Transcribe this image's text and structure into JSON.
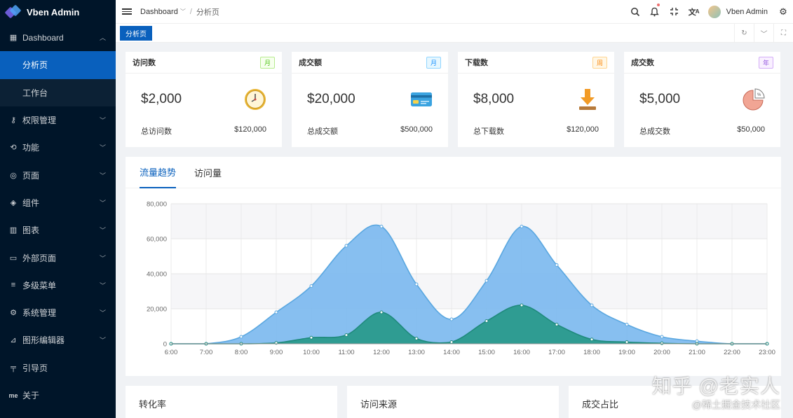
{
  "app": {
    "title": "Vben Admin"
  },
  "sidebar": {
    "dashboard": "Dashboard",
    "sub_items": [
      "分析页",
      "工作台"
    ],
    "items": [
      {
        "label": "权限管理",
        "icon": "key-icon"
      },
      {
        "label": "功能",
        "icon": "function-icon"
      },
      {
        "label": "页面",
        "icon": "page-icon"
      },
      {
        "label": "组件",
        "icon": "component-icon"
      },
      {
        "label": "图表",
        "icon": "chart-icon"
      },
      {
        "label": "外部页面",
        "icon": "monitor-icon"
      },
      {
        "label": "多级菜单",
        "icon": "menu-icon"
      },
      {
        "label": "系统管理",
        "icon": "gear-icon"
      },
      {
        "label": "图形编辑器",
        "icon": "chart-edit-icon"
      },
      {
        "label": "引导页",
        "icon": "roller-icon"
      },
      {
        "label": "关于",
        "icon": "me-icon"
      }
    ]
  },
  "header": {
    "breadcrumb": [
      "Dashboard",
      "分析页"
    ],
    "user": "Vben Admin"
  },
  "tabs": {
    "active": "分析页"
  },
  "cards": [
    {
      "title": "访问数",
      "badge": "月",
      "badge_color": "#52c41a",
      "value": "$2,000",
      "foot_label": "总访问数",
      "foot_value": "$120,000",
      "icon": "clock-icon"
    },
    {
      "title": "成交额",
      "badge": "月",
      "badge_color": "#1890ff",
      "value": "$20,000",
      "foot_label": "总成交额",
      "foot_value": "$500,000",
      "icon": "credit-card-icon"
    },
    {
      "title": "下载数",
      "badge": "周",
      "badge_color": "#fa8c16",
      "value": "$8,000",
      "foot_label": "总下载数",
      "foot_value": "$120,000",
      "icon": "download-icon"
    },
    {
      "title": "成交数",
      "badge": "年",
      "badge_color": "#9254de",
      "value": "$5,000",
      "foot_label": "总成交数",
      "foot_value": "$50,000",
      "icon": "pie-icon"
    }
  ],
  "chart_tabs": [
    "流量趋势",
    "访问量"
  ],
  "chart_data": {
    "type": "area",
    "x": [
      "6:00",
      "7:00",
      "8:00",
      "9:00",
      "10:00",
      "11:00",
      "12:00",
      "13:00",
      "14:00",
      "15:00",
      "16:00",
      "17:00",
      "18:00",
      "19:00",
      "20:00",
      "21:00",
      "22:00",
      "23:00"
    ],
    "ylim": [
      0,
      80000
    ],
    "yticks": [
      "0",
      "20,000",
      "40,000",
      "60,000",
      "80,000"
    ],
    "series": [
      {
        "values": [
          0,
          0,
          4000,
          18000,
          33000,
          56000,
          67000,
          34000,
          14000,
          36000,
          67000,
          45000,
          22000,
          11000,
          4000,
          1500,
          0,
          0
        ],
        "color": "#7ab8ee"
      },
      {
        "values": [
          0,
          0,
          0,
          500,
          3500,
          5000,
          18000,
          3000,
          1000,
          13000,
          22000,
          11000,
          2500,
          1000,
          300,
          0,
          0,
          0
        ],
        "color": "#2a9a8c"
      }
    ],
    "grid": true
  },
  "bottom": [
    "转化率",
    "访问来源",
    "成交占比"
  ],
  "watermark": {
    "line1": "知乎 @老实人",
    "line2": "@稀土掘金技术社区"
  }
}
